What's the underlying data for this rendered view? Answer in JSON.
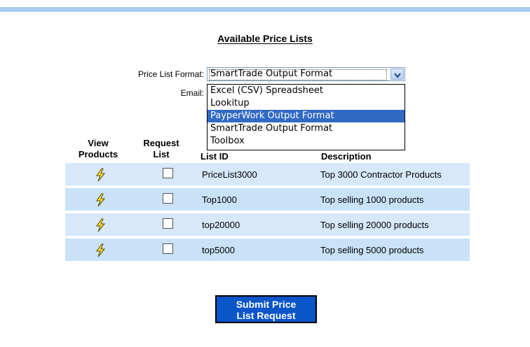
{
  "title": "Available Price Lists",
  "form": {
    "format_label": "Price List Format:",
    "email_label": "Email:",
    "format_selected": "SmartTrade Output Format",
    "format_options": [
      "Excel (CSV) Spreadsheet",
      "Lookitup",
      "PayperWork Output Format",
      "SmartTrade Output Format",
      "Toolbox"
    ],
    "highlighted_option": "PayperWork Output Format"
  },
  "table": {
    "headers": {
      "view_products": "View\nProducts",
      "request_list": "Request\nList",
      "list_id": "List ID",
      "description": "Description"
    },
    "rows": [
      {
        "list_id": "PriceList3000",
        "description": "Top 3000 Contractor Products",
        "checked": false
      },
      {
        "list_id": "Top1000",
        "description": "Top selling 1000 products",
        "checked": false
      },
      {
        "list_id": "top20000",
        "description": "Top selling 20000 products",
        "checked": false
      },
      {
        "list_id": "top5000",
        "description": "Top selling 5000 products",
        "checked": false
      }
    ]
  },
  "submit_label": "Submit Price\nList Request",
  "icons": {
    "view": "lightning-bolt-icon",
    "dropdown": "chevron-down-icon"
  },
  "colors": {
    "top_bar": "#a9cdf0",
    "row_bg": "#d6e8fa",
    "row_alt_bg": "#c9e2f7",
    "selected_option": "#316ac5",
    "submit_bg": "#0a55c8"
  }
}
